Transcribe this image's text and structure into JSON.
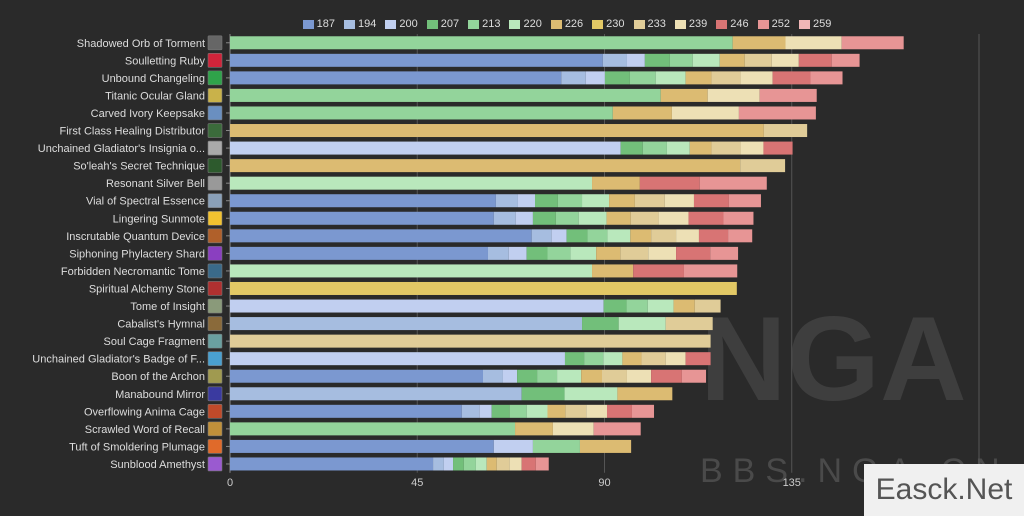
{
  "chart_data": {
    "type": "bar",
    "orientation": "horizontal",
    "stacked": true,
    "title": "",
    "xlabel": "",
    "ylabel": "",
    "xlim": [
      0,
      180
    ],
    "xticks": [
      0,
      45,
      90,
      135
    ],
    "grid": true,
    "legend_position": "top",
    "legend": [
      "187",
      "194",
      "200",
      "207",
      "213",
      "220",
      "226",
      "230",
      "233",
      "239",
      "246",
      "252",
      "259"
    ],
    "colors": {
      "187": "#7b98d0",
      "194": "#a6bde0",
      "200": "#c1cff0",
      "207": "#72bf7a",
      "213": "#93d49b",
      "220": "#b9e8bc",
      "226": "#dcbb72",
      "230": "#e2c865",
      "233": "#e0cc98",
      "239": "#ede0b5",
      "246": "#d87474",
      "252": "#e79595",
      "259": "#f0b6b6"
    },
    "categories": [
      {
        "name": "Shadowed Orb of Torment",
        "icon": "orb-icon",
        "icon_color": "#666",
        "segments": [
          [
            "213",
            120.8
          ],
          [
            "226",
            12.7
          ],
          [
            "239",
            13.5
          ],
          [
            "252",
            14.9
          ]
        ]
      },
      {
        "name": "Soulletting Ruby",
        "icon": "ruby-icon",
        "icon_color": "#d0243a",
        "segments": [
          [
            "187",
            89.6
          ],
          [
            "194",
            5.8
          ],
          [
            "200",
            4.3
          ],
          [
            "207",
            6.0
          ],
          [
            "213",
            5.5
          ],
          [
            "220",
            6.5
          ],
          [
            "226",
            6.0
          ],
          [
            "233",
            6.5
          ],
          [
            "239",
            6.5
          ],
          [
            "246",
            7.9
          ],
          [
            "252",
            6.7
          ]
        ]
      },
      {
        "name": "Unbound Changeling",
        "icon": "changeling-icon",
        "icon_color": "#2fa34a",
        "segments": [
          [
            "187",
            79.6
          ],
          [
            "194",
            5.9
          ],
          [
            "200",
            4.6
          ],
          [
            "207",
            6.0
          ],
          [
            "213",
            6.2
          ],
          [
            "220",
            7.2
          ],
          [
            "226",
            6.2
          ],
          [
            "233",
            7.0
          ],
          [
            "239",
            7.7
          ],
          [
            "246",
            9.1
          ],
          [
            "252",
            7.7
          ]
        ]
      },
      {
        "name": "Titanic Ocular Gland",
        "icon": "gland-icon",
        "icon_color": "#c9b24a",
        "segments": [
          [
            "213",
            103.5
          ],
          [
            "226",
            11.3
          ],
          [
            "239",
            12.5
          ],
          [
            "252",
            13.7
          ]
        ]
      },
      {
        "name": "Carved Ivory Keepsake",
        "icon": "keepsake-icon",
        "icon_color": "#6a8fc0",
        "segments": [
          [
            "213",
            92.0
          ],
          [
            "226",
            14.2
          ],
          [
            "239",
            16.1
          ],
          [
            "252",
            18.5
          ]
        ]
      },
      {
        "name": "First Class Healing Distributor",
        "icon": "distributor-icon",
        "icon_color": "#3b6b3b",
        "segments": [
          [
            "226",
            128.3
          ],
          [
            "233",
            10.4
          ]
        ]
      },
      {
        "name": "Unchained Gladiator's Insignia o...",
        "icon": "insignia-icon",
        "icon_color": "#aaa",
        "segments": [
          [
            "200",
            93.9
          ],
          [
            "207",
            5.3
          ],
          [
            "213",
            5.8
          ],
          [
            "220",
            5.5
          ],
          [
            "226",
            5.2
          ],
          [
            "233",
            7.0
          ],
          [
            "239",
            5.5
          ],
          [
            "246",
            7.0
          ]
        ]
      },
      {
        "name": "So'leah's Secret Technique",
        "icon": "technique-icon",
        "icon_color": "#2d5a2d",
        "segments": [
          [
            "226",
            122.6
          ],
          [
            "233",
            10.8
          ]
        ]
      },
      {
        "name": "Resonant Silver Bell",
        "icon": "bell-icon",
        "icon_color": "#999",
        "segments": [
          [
            "220",
            87.0
          ],
          [
            "226",
            11.5
          ],
          [
            "246",
            14.4
          ],
          [
            "252",
            16.1
          ]
        ]
      },
      {
        "name": "Vial of Spectral Essence",
        "icon": "vial-icon",
        "icon_color": "#8aa0b8",
        "segments": [
          [
            "187",
            63.9
          ],
          [
            "194",
            5.3
          ],
          [
            "200",
            4.1
          ],
          [
            "207",
            5.5
          ],
          [
            "213",
            5.8
          ],
          [
            "220",
            6.5
          ],
          [
            "226",
            6.2
          ],
          [
            "233",
            7.2
          ],
          [
            "239",
            7.0
          ],
          [
            "246",
            8.4
          ],
          [
            "252",
            7.7
          ]
        ]
      },
      {
        "name": "Lingering Sunmote",
        "icon": "sunmote-icon",
        "icon_color": "#f2c230",
        "segments": [
          [
            "187",
            63.4
          ],
          [
            "194",
            5.3
          ],
          [
            "200",
            4.1
          ],
          [
            "207",
            5.5
          ],
          [
            "213",
            5.5
          ],
          [
            "220",
            6.7
          ],
          [
            "226",
            5.8
          ],
          [
            "233",
            6.7
          ],
          [
            "239",
            7.2
          ],
          [
            "246",
            8.4
          ],
          [
            "252",
            7.2
          ]
        ]
      },
      {
        "name": "Inscrutable Quantum Device",
        "icon": "device-icon",
        "icon_color": "#b0602a",
        "segments": [
          [
            "187",
            72.5
          ],
          [
            "194",
            4.8
          ],
          [
            "200",
            3.6
          ],
          [
            "207",
            5.0
          ],
          [
            "213",
            4.8
          ],
          [
            "220",
            5.5
          ],
          [
            "226",
            5.0
          ],
          [
            "233",
            6.0
          ],
          [
            "239",
            5.5
          ],
          [
            "246",
            7.0
          ],
          [
            "252",
            5.8
          ]
        ]
      },
      {
        "name": "Siphoning Phylactery Shard",
        "icon": "shard-icon",
        "icon_color": "#8a3fc0",
        "segments": [
          [
            "187",
            62.0
          ],
          [
            "194",
            5.0
          ],
          [
            "200",
            4.3
          ],
          [
            "207",
            5.0
          ],
          [
            "213",
            5.5
          ],
          [
            "220",
            6.2
          ],
          [
            "226",
            5.8
          ],
          [
            "233",
            6.7
          ],
          [
            "239",
            6.7
          ],
          [
            "246",
            8.2
          ],
          [
            "252",
            6.7
          ]
        ]
      },
      {
        "name": "Forbidden Necromantic Tome",
        "icon": "tome-icon",
        "icon_color": "#3a6a8a",
        "segments": [
          [
            "220",
            87.0
          ],
          [
            "226",
            9.9
          ],
          [
            "246",
            12.2
          ],
          [
            "252",
            12.8
          ]
        ]
      },
      {
        "name": "Spiritual Alchemy Stone",
        "icon": "stone-icon",
        "icon_color": "#b03030",
        "segments": [
          [
            "230",
            121.8
          ]
        ]
      },
      {
        "name": "Tome of Insight",
        "icon": "insight-icon",
        "icon_color": "#8a9a7a",
        "segments": [
          [
            "200",
            89.8
          ],
          [
            "207",
            5.5
          ],
          [
            "213",
            5.1
          ],
          [
            "220",
            6.2
          ],
          [
            "226",
            5.1
          ],
          [
            "233",
            6.2
          ]
        ]
      },
      {
        "name": "Cabalist's Hymnal",
        "icon": "hymnal-icon",
        "icon_color": "#8a6a3a",
        "segments": [
          [
            "194",
            84.6
          ],
          [
            "207",
            8.8
          ],
          [
            "220",
            11.3
          ],
          [
            "233",
            11.3
          ]
        ]
      },
      {
        "name": "Soul Cage Fragment",
        "icon": "cage-icon",
        "icon_color": "#6aa0a0",
        "segments": [
          [
            "233",
            115.5
          ]
        ]
      },
      {
        "name": "Unchained Gladiator's Badge of F...",
        "icon": "badge-icon",
        "icon_color": "#4aa0d0",
        "segments": [
          [
            "200",
            80.5
          ],
          [
            "207",
            4.6
          ],
          [
            "213",
            4.6
          ],
          [
            "220",
            4.6
          ],
          [
            "226",
            4.6
          ],
          [
            "233",
            5.8
          ],
          [
            "239",
            4.8
          ],
          [
            "246",
            6.0
          ]
        ]
      },
      {
        "name": "Boon of the Archon",
        "icon": "boon-icon",
        "icon_color": "#a09a50",
        "segments": [
          [
            "187",
            60.8
          ],
          [
            "194",
            4.8
          ],
          [
            "200",
            3.4
          ],
          [
            "207",
            4.8
          ],
          [
            "213",
            4.8
          ],
          [
            "220",
            5.8
          ],
          [
            "226",
            5.0
          ],
          [
            "233",
            6.0
          ],
          [
            "239",
            5.8
          ],
          [
            "246",
            7.4
          ],
          [
            "252",
            5.8
          ]
        ]
      },
      {
        "name": "Manabound Mirror",
        "icon": "mirror-icon",
        "icon_color": "#3a3aa0",
        "segments": [
          [
            "194",
            70.1
          ],
          [
            "207",
            10.3
          ],
          [
            "220",
            12.7
          ],
          [
            "226",
            13.2
          ]
        ]
      },
      {
        "name": "Overflowing Anima Cage",
        "icon": "anima-cage-icon",
        "icon_color": "#c04a2a",
        "segments": [
          [
            "187",
            55.7
          ],
          [
            "194",
            4.3
          ],
          [
            "200",
            2.9
          ],
          [
            "207",
            4.3
          ],
          [
            "213",
            4.1
          ],
          [
            "220",
            5.0
          ],
          [
            "226",
            4.3
          ],
          [
            "233",
            5.0
          ],
          [
            "239",
            5.0
          ],
          [
            "246",
            6.0
          ],
          [
            "252",
            5.3
          ]
        ]
      },
      {
        "name": "Scrawled Word of Recall",
        "icon": "scroll-icon",
        "icon_color": "#c0903a",
        "segments": [
          [
            "213",
            68.5
          ],
          [
            "226",
            9.1
          ],
          [
            "239",
            9.8
          ],
          [
            "252",
            11.3
          ]
        ]
      },
      {
        "name": "Tuft of Smoldering Plumage",
        "icon": "plumage-icon",
        "icon_color": "#e06a2a",
        "segments": [
          [
            "187",
            63.4
          ],
          [
            "200",
            9.4
          ],
          [
            "213",
            11.3
          ],
          [
            "226",
            12.3
          ]
        ]
      },
      {
        "name": "Sunblood Amethyst",
        "icon": "amethyst-icon",
        "icon_color": "#9a5ad0",
        "segments": [
          [
            "187",
            48.8
          ],
          [
            "194",
            2.6
          ],
          [
            "200",
            2.2
          ],
          [
            "207",
            2.6
          ],
          [
            "213",
            2.9
          ],
          [
            "220",
            2.6
          ],
          [
            "226",
            2.4
          ],
          [
            "233",
            3.1
          ],
          [
            "239",
            2.9
          ],
          [
            "246",
            3.4
          ],
          [
            "252",
            3.1
          ]
        ]
      }
    ]
  },
  "watermark": {
    "logo_text": "NGA",
    "site_text": "BBS.NGA.CN",
    "corner_text": "Easck.Net"
  }
}
